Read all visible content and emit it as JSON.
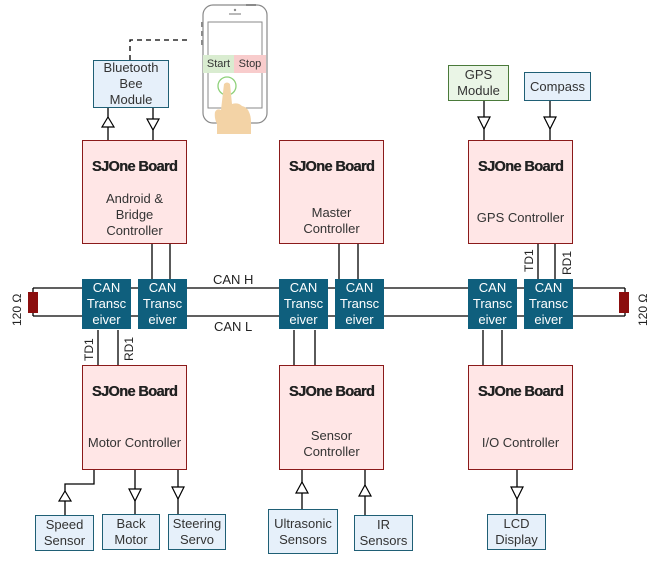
{
  "diagram": {
    "bus": {
      "can_h_label": "CAN H",
      "can_l_label": "CAN L",
      "left_terminator": "120 Ω",
      "right_terminator": "120 Ω"
    },
    "transceiver_label": "CAN Transc eiver",
    "transceiver_lines": [
      "CAN",
      "Transc",
      "eiver"
    ],
    "signal_labels": {
      "td": "TD1",
      "rd": "RD1"
    },
    "boards": [
      {
        "id": "android",
        "title": "SJOne Board",
        "lines": [
          "Android &",
          "Bridge",
          "Controller"
        ]
      },
      {
        "id": "master",
        "title": "SJOne Board",
        "lines": [
          "Master",
          "Controller"
        ]
      },
      {
        "id": "gps",
        "title": "SJOne Board",
        "lines": [
          "GPS Controller"
        ]
      },
      {
        "id": "motor",
        "title": "SJOne Board",
        "lines": [
          "Motor Controller"
        ]
      },
      {
        "id": "sensor",
        "title": "SJOne Board",
        "lines": [
          "Sensor",
          "Controller"
        ]
      },
      {
        "id": "io",
        "title": "SJOne Board",
        "lines": [
          "I/O Controller"
        ]
      }
    ],
    "peripherals": {
      "bluetooth": [
        "Bluetooth",
        "Bee",
        "Module"
      ],
      "gps_module": [
        "GPS",
        "Module"
      ],
      "compass": [
        "Compass"
      ],
      "speed_sensor": [
        "Speed",
        "Sensor"
      ],
      "back_motor": [
        "Back",
        "Motor"
      ],
      "steering_servo": [
        "Steering",
        "Servo"
      ],
      "ultrasonic": [
        "Ultrasonic",
        "Sensors"
      ],
      "ir": [
        "IR",
        "Sensors"
      ],
      "lcd": [
        "LCD",
        "Display"
      ]
    },
    "phone": {
      "start_label": "Start",
      "stop_label": "Stop"
    },
    "colors": {
      "board_fill": "#ffe6e6",
      "board_border": "#8b1a1a",
      "transceiver_fill": "#0f5f7d",
      "peripheral_fill": "#e6f0fa",
      "gps_fill": "#eaf5e6",
      "resistor": "#8b0e0e",
      "start_bg": "#d9ecd0",
      "stop_bg": "#f8cccc"
    }
  }
}
